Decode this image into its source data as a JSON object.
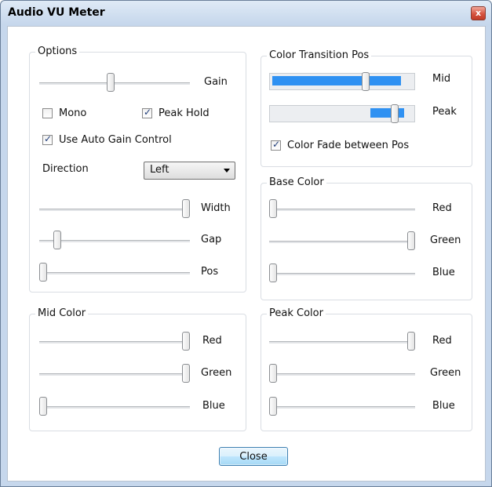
{
  "window": {
    "title": "Audio VU Meter",
    "close_glyph": "x"
  },
  "options": {
    "label": "Options",
    "gain": {
      "label": "Gain",
      "value": 0.47
    },
    "mono": {
      "label": "Mono",
      "checked": false
    },
    "peak_hold": {
      "label": "Peak Hold",
      "checked": true
    },
    "auto_gain": {
      "label": "Use Auto Gain Control",
      "checked": true
    },
    "direction": {
      "label": "Direction",
      "value": "Left"
    },
    "width": {
      "label": "Width",
      "value": 1.0
    },
    "gap": {
      "label": "Gap",
      "value": 0.1
    },
    "pos": {
      "label": "Pos",
      "value": 0.0
    }
  },
  "color_transition": {
    "label": "Color Transition Pos",
    "mid": {
      "label": "Mid",
      "value": 0.67
    },
    "peak": {
      "label": "Peak",
      "value": 0.88
    },
    "fade": {
      "label": "Color Fade between Pos",
      "checked": true
    }
  },
  "base_color": {
    "label": "Base Color",
    "red": {
      "label": "Red",
      "value": 0.0
    },
    "green": {
      "label": "Green",
      "value": 1.0
    },
    "blue": {
      "label": "Blue",
      "value": 0.0
    }
  },
  "mid_color": {
    "label": "Mid Color",
    "red": {
      "label": "Red",
      "value": 1.0
    },
    "green": {
      "label": "Green",
      "value": 1.0
    },
    "blue": {
      "label": "Blue",
      "value": 0.0
    }
  },
  "peak_color": {
    "label": "Peak Color",
    "red": {
      "label": "Red",
      "value": 1.0
    },
    "green": {
      "label": "Green",
      "value": 0.0
    },
    "blue": {
      "label": "Blue",
      "value": 0.0
    }
  },
  "buttons": {
    "close": "Close"
  },
  "colors": {
    "accent_fill": "#2f91f2"
  }
}
